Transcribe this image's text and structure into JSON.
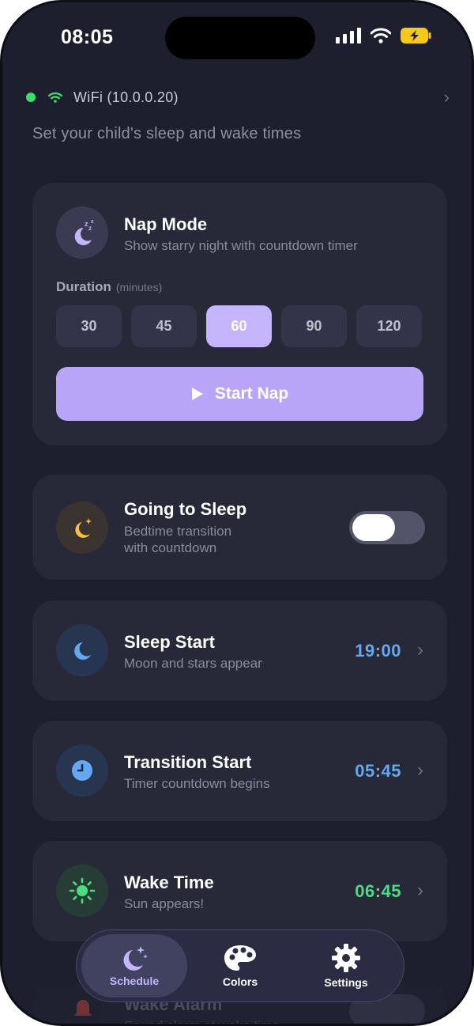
{
  "status_bar": {
    "time": "08:05"
  },
  "connection": {
    "label": "WiFi (10.0.0.20)",
    "status_color": "#3bdc6e"
  },
  "subtitle": "Set your child's sleep and wake times",
  "nap_mode": {
    "title": "Nap Mode",
    "description": "Show starry night with countdown timer",
    "duration_label": "Duration",
    "duration_unit": "(minutes)",
    "options": [
      "30",
      "45",
      "60",
      "90",
      "120"
    ],
    "selected": "60",
    "start_label": "Start Nap",
    "accent": "#c4b5fd"
  },
  "going_to_sleep": {
    "title": "Going to Sleep",
    "description_line1": "Bedtime transition",
    "description_line2": "with countdown",
    "enabled": true
  },
  "schedule": [
    {
      "title": "Sleep Start",
      "description": "Moon and stars appear",
      "time": "19:00",
      "icon": "moon-icon",
      "color": "#63a8f0"
    },
    {
      "title": "Transition Start",
      "description": "Timer countdown begins",
      "time": "05:45",
      "icon": "clock-icon",
      "color": "#63a8f0"
    },
    {
      "title": "Wake Time",
      "description": "Sun appears!",
      "time": "06:45",
      "icon": "sun-icon",
      "color": "#4ade80"
    }
  ],
  "wake_alarm": {
    "title": "Wake Alarm",
    "description": "Sound alarm at wake time"
  },
  "tabs": [
    {
      "label": "Schedule",
      "icon": "moon-stars-icon",
      "active": true
    },
    {
      "label": "Colors",
      "icon": "palette-icon",
      "active": false
    },
    {
      "label": "Settings",
      "icon": "gear-icon",
      "active": false
    }
  ]
}
